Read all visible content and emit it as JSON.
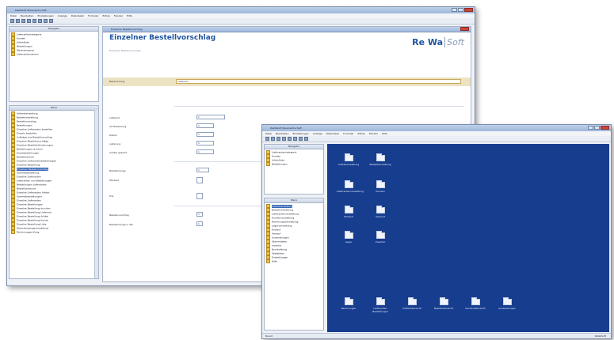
{
  "back_window": {
    "title": "ReWaSoft Warenwirtschaft",
    "menu": [
      "Datei",
      "Bearbeiten",
      "Einstellungen",
      "Anzeige",
      "Datenbank",
      "Formular",
      "Extras",
      "Fenster",
      "Hilfe"
    ],
    "navigator_title": "Navigator",
    "top_tree": [
      "Lieferantenkategorie",
      "Kunden",
      "Artikelliste",
      "Bestellungen",
      "Wareneingang",
      "Lieferantenstamm"
    ],
    "menu_tree_title": "Menü",
    "menu_tree": [
      {
        "label": "Artikelverwaltung",
        "selected": false
      },
      {
        "label": "Bestellverwaltung",
        "selected": false
      },
      {
        "label": "Bestellvorschlag",
        "selected": false
      },
      {
        "label": "Bestellungen",
        "selected": false
      },
      {
        "label": "Einzelne Lieferanten bestellen",
        "selected": false
      },
      {
        "label": "Einzeln bestellen",
        "selected": false
      },
      {
        "label": "Aufträge aus Bestellvorschlag",
        "selected": false
      },
      {
        "label": "Einzelne Bestellvorschläge",
        "selected": false
      },
      {
        "label": "Einzelne Bestellanforderungen",
        "selected": false
      },
      {
        "label": "Bestellungen drucken",
        "selected": false
      },
      {
        "label": "Einzelbestellungen",
        "selected": false
      },
      {
        "label": "Bestellscheine",
        "selected": false
      },
      {
        "label": "Einzelne Lieferantenbestellungen",
        "selected": false
      },
      {
        "label": "Einzelne Bestellung",
        "selected": false
      },
      {
        "label": "Einzelner Bestellvorschlag",
        "selected": true
      },
      {
        "label": "Sammelbestellung",
        "selected": false
      },
      {
        "label": "Einzelne Lieferanten",
        "selected": false
      },
      {
        "label": "Lieferanten und Bestellungen",
        "selected": false
      },
      {
        "label": "Bestellungen Lieferanten",
        "selected": false
      },
      {
        "label": "Bestellübersicht",
        "selected": false
      },
      {
        "label": "Einzelne Lieferanten Artikel",
        "selected": false
      },
      {
        "label": "Sammelbestellungen",
        "selected": false
      },
      {
        "label": "Einzelne Lieferanten",
        "selected": false
      },
      {
        "label": "Einzelne Bestellungen",
        "selected": false
      },
      {
        "label": "Einzelne Bestellung drucken",
        "selected": false
      },
      {
        "label": "Einzelne Bestellung Lieferant",
        "selected": false
      },
      {
        "label": "Einzelne Bestellung Artikel",
        "selected": false
      },
      {
        "label": "Einzelne Bestellung Kunde",
        "selected": false
      },
      {
        "label": "Einzelne Bestellung Liste",
        "selected": false
      },
      {
        "label": "Wareneingangsverwaltung",
        "selected": false
      },
      {
        "label": "Rechnungsprüfung",
        "selected": false
      }
    ],
    "form_window_title": "Einzelner Bestellvorschlag",
    "form": {
      "title": "Einzelner Bestellvorschlag",
      "brand_main": "Re Wa",
      "brand_sub": "Soft",
      "subtitle": "Einzelner Bestellvorschlag",
      "fields": [
        {
          "label": "Bezeichnung",
          "value": "Lieferant"
        },
        {
          "label": "Lieferant",
          "value": "1"
        },
        {
          "label": "Art Bestellung",
          "value": "1"
        },
        {
          "label": "Datum",
          "value": "1"
        },
        {
          "label": "Lieferung",
          "value": "1"
        },
        {
          "label": "Anzahl gesamt",
          "value": "1"
        },
        {
          "label": "Bestellmenge",
          "value": "1"
        },
        {
          "label": "Mindest",
          "value": ""
        },
        {
          "label": "Frei",
          "value": ""
        },
        {
          "label": "Bestellvorschlag",
          "value": "1"
        },
        {
          "label": "Bestellmenge in Stk",
          "value": "1"
        }
      ]
    }
  },
  "front_window": {
    "title": "ReWaSoft Warenwirtschaft",
    "menu": [
      "Datei",
      "Bearbeiten",
      "Einstellungen",
      "Anzeige",
      "Datenbank",
      "Formular",
      "Extras",
      "Fenster",
      "Hilfe"
    ],
    "navigator_title": "Navigator",
    "top_tree": [
      "Lieferantenkategorie",
      "Kunden",
      "Artikelliste",
      "Bestellungen"
    ],
    "menu_tree_title": "Menü",
    "menu_tree": [
      {
        "label": "Artikelverwaltung",
        "selected": true
      },
      {
        "label": "Bestellverwaltung",
        "selected": false
      },
      {
        "label": "Lieferantenverwaltung",
        "selected": false
      },
      {
        "label": "Kundenverwaltung",
        "selected": false
      },
      {
        "label": "Rechnungsverwaltung",
        "selected": false
      },
      {
        "label": "Lagerverwaltung",
        "selected": false
      },
      {
        "label": "Einkauf",
        "selected": false
      },
      {
        "label": "Verkauf",
        "selected": false
      },
      {
        "label": "Auswertungen",
        "selected": false
      },
      {
        "label": "Stammdaten",
        "selected": false
      },
      {
        "label": "Inventur",
        "selected": false
      },
      {
        "label": "Buchhaltung",
        "selected": false
      },
      {
        "label": "Statistiken",
        "selected": false
      },
      {
        "label": "Einstellungen",
        "selected": false
      },
      {
        "label": "Hilfe",
        "selected": false
      }
    ],
    "desktop_icons": [
      {
        "label": "Artikelverwaltung"
      },
      {
        "label": "Bestellverwaltung"
      },
      {
        "label": "Lieferantenverwaltung"
      },
      {
        "label": "Kunden"
      },
      {
        "label": "Einkauf"
      },
      {
        "label": "Verkauf"
      },
      {
        "label": "Lager"
      },
      {
        "label": "Inventur"
      },
      {
        "label": "Rechnungen"
      },
      {
        "label": "Lieferanten Bestellungen"
      },
      {
        "label": "Artikelübersicht"
      },
      {
        "label": "Bestellübersicht"
      },
      {
        "label": "Kundenübersicht"
      },
      {
        "label": "Auswertungen"
      }
    ],
    "status_left": "Bereit",
    "status_right": "ReWaSoft"
  }
}
